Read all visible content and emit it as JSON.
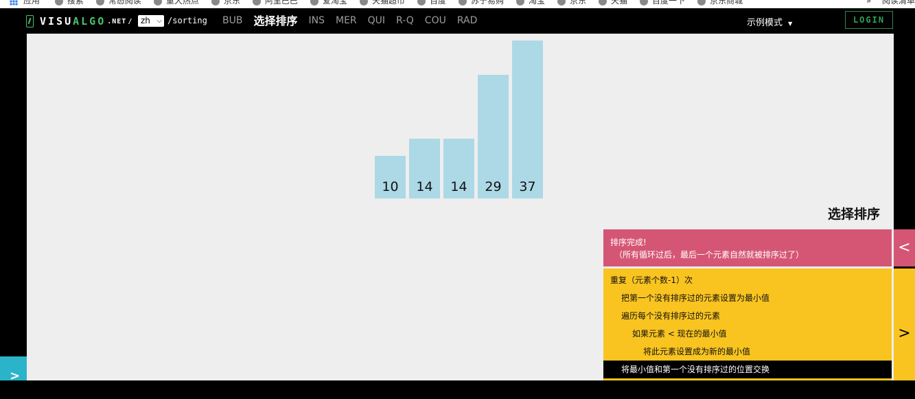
{
  "bookmarks": {
    "apps_label": "应用",
    "items": [
      "搜索",
      "常态阅读",
      "重大热点",
      "京东",
      "阿里巴巴",
      "爱淘宝",
      "天猫超市",
      "百度",
      "苏宁易购",
      "淘宝",
      "京东",
      "天猫",
      "百度一下",
      "京东商城"
    ],
    "overflow": "»",
    "reading_list": "阅读清单"
  },
  "nav": {
    "brand_visu": "VISU",
    "brand_algo": "ALGO",
    "brand_net": ".NET",
    "slash": "/",
    "lang_value": "zh",
    "path": "/sorting",
    "algos": [
      {
        "label": "BUB",
        "active": false
      },
      {
        "label": "选择排序",
        "active": true
      },
      {
        "label": "INS",
        "active": false
      },
      {
        "label": "MER",
        "active": false
      },
      {
        "label": "QUI",
        "active": false
      },
      {
        "label": "R-Q",
        "active": false
      },
      {
        "label": "COU",
        "active": false
      },
      {
        "label": "RAD",
        "active": false
      }
    ],
    "mode_label": "示例模式",
    "mode_caret": "▼",
    "login_label": "LOGIN"
  },
  "viz": {
    "title": "选择排序",
    "bar_color": "#add8e6",
    "array": [
      10,
      14,
      14,
      29,
      37
    ]
  },
  "status": {
    "line1": "排序完成!",
    "line2": "（所有循环过后，最后一个元素自然就被排序过了）",
    "toggle": "<",
    "color": "#d55674"
  },
  "code": {
    "color": "#f9c420",
    "toggle": ">",
    "active_index": 5,
    "lines": [
      "重复（元素个数-1）次",
      "把第一个没有排序过的元素设置为最小值",
      "遍历每个没有排序过的元素",
      "如果元素 < 现在的最小值",
      "将此元素设置成为新的最小值",
      "将最小值和第一个没有排序过的位置交换"
    ]
  },
  "left_toggle": ">"
}
